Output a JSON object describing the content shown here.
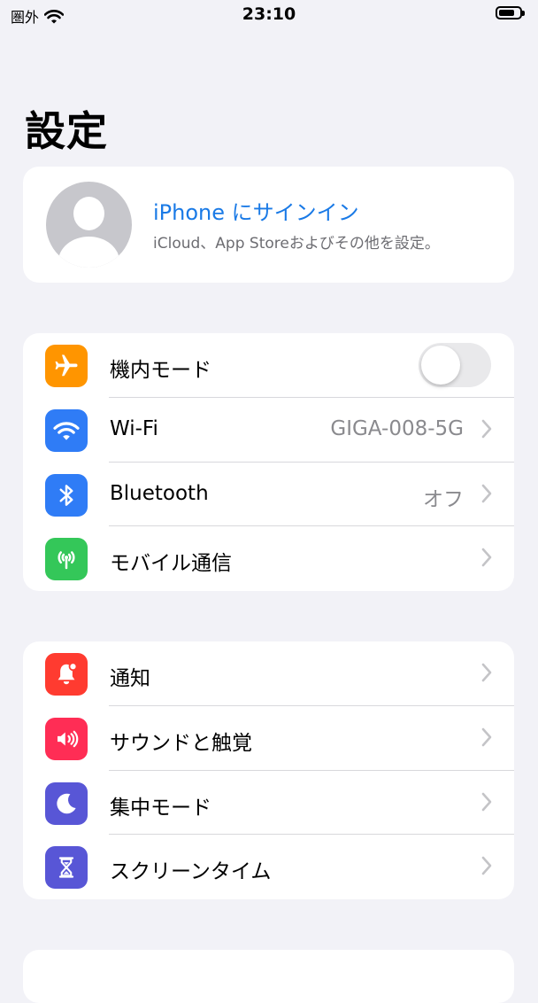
{
  "status_bar": {
    "carrier": "圏外",
    "time": "23:10"
  },
  "page": {
    "title": "設定"
  },
  "profile": {
    "title": "iPhone にサインイン",
    "subtitle": "iCloud、App Storeおよびその他を設定。"
  },
  "groups": [
    {
      "rows": [
        {
          "label": "機内モード",
          "icon": "airplane-icon",
          "color": "#ff9500",
          "toggle": false
        },
        {
          "label": "Wi-Fi",
          "value": "GIGA-008-5G",
          "icon": "wifi-icon",
          "color": "#2f7cf6"
        },
        {
          "label": "Bluetooth",
          "value": "オフ",
          "icon": "bluetooth-icon",
          "color": "#2f7cf6"
        },
        {
          "label": "モバイル通信",
          "icon": "antenna-icon",
          "color": "#34c759"
        }
      ]
    },
    {
      "rows": [
        {
          "label": "通知",
          "icon": "bell-icon",
          "color": "#ff3b30"
        },
        {
          "label": "サウンドと触覚",
          "icon": "speaker-icon",
          "color": "#ff2d55"
        },
        {
          "label": "集中モード",
          "icon": "moon-icon",
          "color": "#5856d6"
        },
        {
          "label": "スクリーンタイム",
          "icon": "hourglass-icon",
          "color": "#5856d6"
        }
      ]
    }
  ]
}
